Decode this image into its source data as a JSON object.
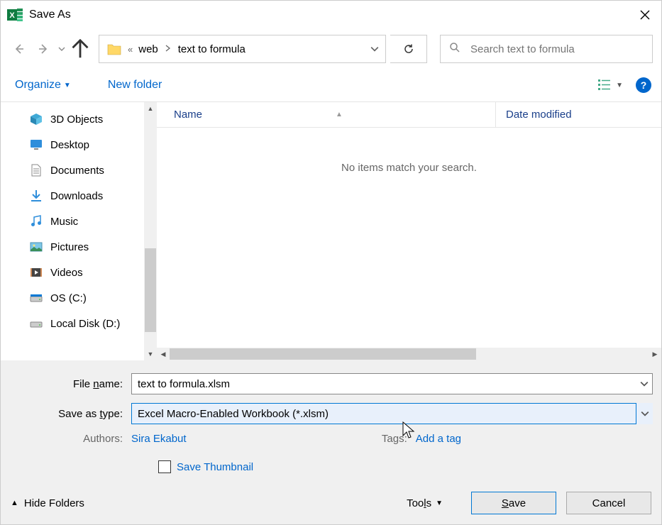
{
  "title": "Save As",
  "breadcrumb": {
    "sep": "«",
    "item1": "web",
    "item2": "text to formula"
  },
  "search": {
    "placeholder": "Search text to formula"
  },
  "toolbar": {
    "organize": "Organize",
    "new_folder": "New folder"
  },
  "sidebar": {
    "items": [
      {
        "label": "3D Objects"
      },
      {
        "label": "Desktop"
      },
      {
        "label": "Documents"
      },
      {
        "label": "Downloads"
      },
      {
        "label": "Music"
      },
      {
        "label": "Pictures"
      },
      {
        "label": "Videos"
      },
      {
        "label": "OS (C:)"
      },
      {
        "label": "Local Disk (D:)"
      }
    ]
  },
  "columns": {
    "name": "Name",
    "date": "Date modified"
  },
  "empty_message": "No items match your search.",
  "form": {
    "file_name_label_pre": "File ",
    "file_name_label_ul": "n",
    "file_name_label_post": "ame:",
    "file_name_value": "text to formula.xlsm",
    "save_type_label_pre": "Save as ",
    "save_type_label_ul": "t",
    "save_type_label_post": "ype:",
    "save_type_value": "Excel Macro-Enabled Workbook (*.xlsm)",
    "authors_label": "Authors:",
    "authors_value": "Sira Ekabut",
    "tags_label": "Tags:",
    "tags_value": "Add a tag",
    "thumbnail_label": "Save Thumbnail"
  },
  "footer": {
    "hide_folders": "Hide Folders",
    "tools_pre": "Too",
    "tools_ul": "l",
    "tools_post": "s",
    "save_ul": "S",
    "save_post": "ave",
    "cancel": "Cancel"
  }
}
